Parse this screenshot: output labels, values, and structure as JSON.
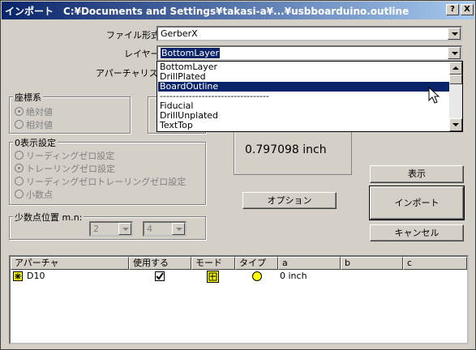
{
  "window": {
    "title": "インポート　C:¥Documents and Settings¥takasi-a¥...¥usbboarduino.outline",
    "help_button": "?",
    "close_button": "X"
  },
  "form": {
    "file_format_label": "ファイル形式:",
    "file_format_value": "GerberX",
    "layer_label": "レイヤー:",
    "layer_value": "BottomLayer",
    "aperture_list_label": "アパーチャリスト:"
  },
  "layer_dropdown": {
    "items": [
      "BottomLayer",
      "DrillPlated",
      "BoardOutline",
      "----------------------------------",
      "Fiducial",
      "DrillUnplated",
      "TextTop"
    ],
    "highlighted_index": 2
  },
  "coord_group": {
    "title": "座標系",
    "options": [
      "絶対値",
      "相対値"
    ]
  },
  "zero_group": {
    "title": "0表示設定",
    "options": [
      "リーディングゼロ設定",
      "トレーリングゼロ設定",
      "リーディングゼロトレーリングゼロ設定",
      "小数点"
    ]
  },
  "decimal_group": {
    "title": "少数点位置 m.n:",
    "m_value": "2",
    "n_value": "4"
  },
  "value_display": "0.797098 inch",
  "buttons": {
    "options": "オプション",
    "show": "表示",
    "import": "インポート",
    "cancel": "キャンセル"
  },
  "table": {
    "columns": [
      "アパーチャ",
      "使用する",
      "モード",
      "タイプ",
      "a",
      "b",
      "c"
    ],
    "rows": [
      {
        "aperture": "D10",
        "use": true,
        "mode_icon": "flash-mode-icon",
        "type_icon": "circle-type-icon",
        "a": "0 inch",
        "b": "",
        "c": ""
      }
    ]
  },
  "colors": {
    "title_start": "#0a246a",
    "title_end": "#a6caf0",
    "selection": "#0a246a",
    "type_circle": "#ffff00"
  }
}
